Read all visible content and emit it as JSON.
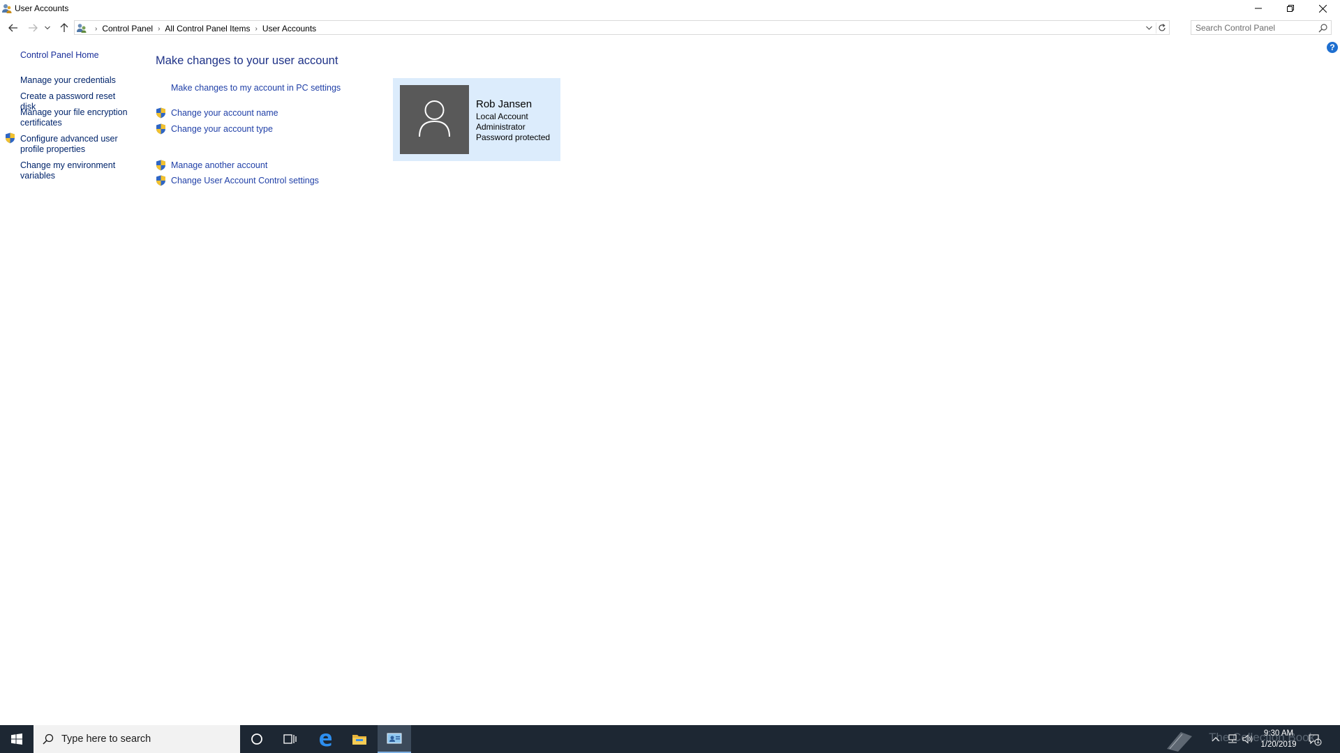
{
  "window": {
    "title": "User Accounts"
  },
  "address": {
    "crumbs": [
      "Control Panel",
      "All Control Panel Items",
      "User Accounts"
    ]
  },
  "search": {
    "placeholder": "Search Control Panel"
  },
  "leftpane": {
    "home": "Control Panel Home",
    "items": [
      "Manage your credentials",
      "Create a password reset disk",
      "Manage your file encryption certificates",
      "Configure advanced user profile properties",
      "Change my environment variables"
    ]
  },
  "main": {
    "title": "Make changes to your user account",
    "links": {
      "pc_settings": "Make changes to my account in PC settings",
      "change_name": "Change your account name",
      "change_type": "Change your account type",
      "manage_another": "Manage another account",
      "uac_settings": "Change User Account Control settings"
    }
  },
  "account": {
    "name": "Rob Jansen",
    "type": "Local Account",
    "role": "Administrator",
    "status": "Password protected"
  },
  "taskbar": {
    "search_placeholder": "Type here to search",
    "time": "9:30 AM",
    "date": "1/20/2019",
    "watermark": "The Collection Book",
    "notification_count": "1"
  },
  "colors": {
    "link": "#1f3fa7",
    "title": "#1e3287",
    "tile_bg": "#dcecfc",
    "avatar_bg": "#595959",
    "taskbar_bg": "#1d2733"
  }
}
